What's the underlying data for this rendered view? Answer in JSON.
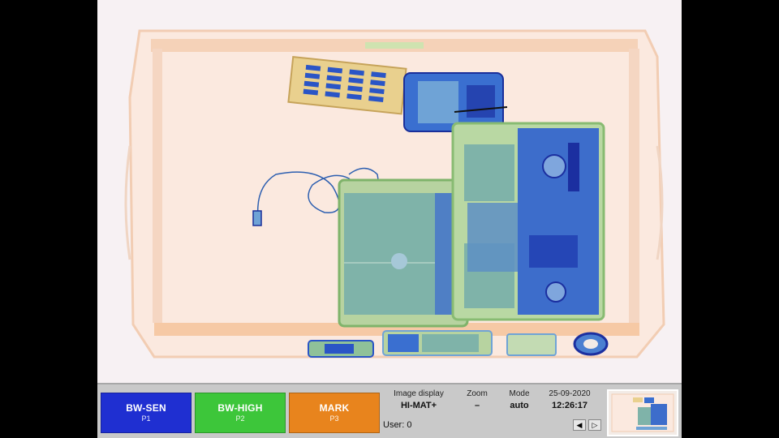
{
  "colors": {
    "bw_sen": "#1f2fd1",
    "bw_high": "#3dc63a",
    "mark": "#e8841d",
    "tray": "#f3c7a3",
    "organic": "#7fb3a9",
    "dense": "#2a55c6",
    "status_bg": "#c9c9c9"
  },
  "buttons": [
    {
      "label": "BW-SEN",
      "key": "P1"
    },
    {
      "label": "BW-HIGH",
      "key": "P2"
    },
    {
      "label": "MARK",
      "key": "P3"
    }
  ],
  "status": {
    "image_display_label": "Image display",
    "image_display_value": "HI-MAT+",
    "zoom_label": "Zoom",
    "zoom_value": "–",
    "mode_label": "Mode",
    "mode_value": "auto",
    "date": "25-09-2020",
    "time": "12:26:17",
    "user": "User: 0"
  },
  "nav": {
    "prev_icon": "◀",
    "next_icon": "▷"
  },
  "icons": [
    "prev-arrow-icon",
    "next-arrow-icon",
    "apple-logo-icon"
  ]
}
